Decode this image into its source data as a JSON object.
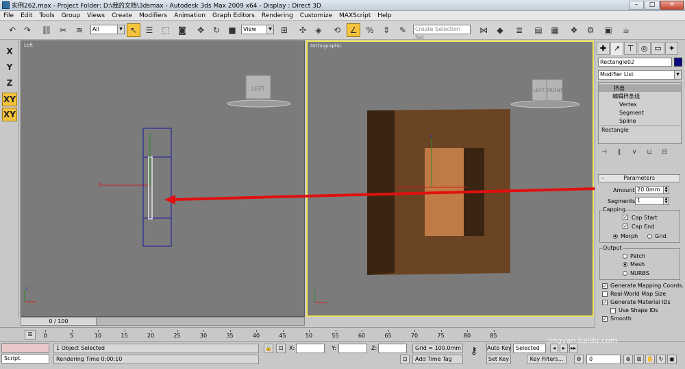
{
  "window": {
    "title": "实例262.max   - Project Folder: D:\\我的文档\\3dsmax    - Autodesk 3ds Max  2009 x64    - Display : Direct 3D",
    "buttons": [
      "–",
      "□",
      "✕"
    ]
  },
  "menu": [
    "File",
    "Edit",
    "Tools",
    "Group",
    "Views",
    "Create",
    "Modifiers",
    "Animation",
    "Graph Editors",
    "Rendering",
    "Customize",
    "MAXScript",
    "Help"
  ],
  "toolbar": {
    "filter_value": "All",
    "coord_value": "View",
    "selection_set_placeholder": "Create Selection Set",
    "icons": [
      "undo-icon",
      "redo-icon",
      "link-icon",
      "unlink-icon",
      "bind-spacewarp-icon",
      "select-icon",
      "select-region-icon",
      "window-crossing-icon",
      "select-by-name-icon",
      "move-icon",
      "rotate-icon",
      "scale-icon",
      "pivot-icon",
      "snap-toggle-icon",
      "angle-snap-icon",
      "percent-snap-icon",
      "spinner-snap-icon",
      "mirror-icon",
      "align-icon",
      "layer-manager-icon",
      "curve-editor-icon",
      "schematic-view-icon",
      "material-editor-icon",
      "render-setup-icon",
      "render-frame-icon",
      "quick-render-icon"
    ]
  },
  "axis_constraints": [
    "X",
    "Y",
    "Z",
    "XY",
    "XY"
  ],
  "viewports": {
    "left": {
      "label": "Left",
      "cube_label": "LEFT"
    },
    "ortho": {
      "label": "Orthographic",
      "cube_labels": [
        "LEFT",
        "FRONT"
      ]
    }
  },
  "command_panel": {
    "object_name": "Rectangle02",
    "object_color": "#0a0a80",
    "modifier_list": "Modifier List",
    "stack": [
      {
        "label": "挤出",
        "selected": true
      },
      {
        "label": "编辑样条线",
        "selected": false
      },
      {
        "label": "Vertex",
        "selected": false
      },
      {
        "label": "Segment",
        "selected": false
      },
      {
        "label": "Spline",
        "selected": false
      },
      {
        "label": "Rectangle",
        "selected": false
      }
    ],
    "parameters": {
      "title": "Parameters",
      "amount_label": "Amount:",
      "amount_value": "20.0mm",
      "segments_label": "Segments:",
      "segments_value": "1",
      "capping_title": "Capping",
      "cap_start": "Cap Start",
      "cap_end": "Cap End",
      "morph": "Morph",
      "grid": "Grid",
      "output_title": "Output",
      "patch": "Patch",
      "mesh": "Mesh",
      "nurbs": "NURBS",
      "gen_mapping": "Generate Mapping Coords.",
      "real_world": "Real-World Map Size",
      "gen_material": "Generate Material IDs",
      "use_shape": "Use Shape IDs",
      "smooth": "Smooth"
    }
  },
  "timeline": {
    "slider": "0 / 100",
    "ticks": [
      "0",
      "5",
      "10",
      "15",
      "20",
      "25",
      "30",
      "35",
      "40",
      "45",
      "50",
      "55",
      "60",
      "65",
      "70",
      "75",
      "80",
      "85"
    ]
  },
  "status": {
    "script_label": "Script.",
    "selection": "1 Object Selected",
    "render_time": "Rendering Time  0:00:10",
    "x_label": "X:",
    "y_label": "Y:",
    "z_label": "Z:",
    "grid": "Grid = 100.0mm",
    "add_time_tag": "Add Time Tag",
    "auto_key": "Auto Key",
    "set_key": "Set Key",
    "selected": "Selected",
    "key_filters": "Key Filters...",
    "frame_value": "0"
  },
  "watermark": "jingyan.baidu.com"
}
